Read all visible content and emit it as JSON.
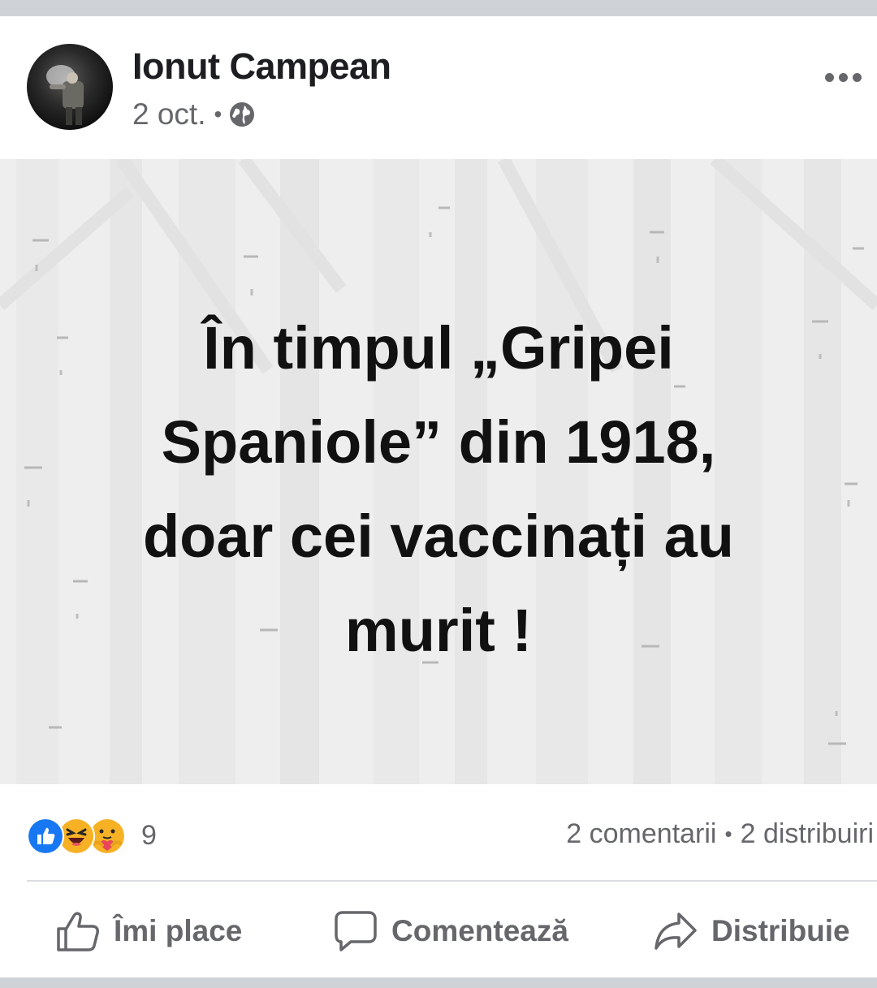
{
  "post": {
    "author": "Ionut Campean",
    "date": "2 oct.",
    "meta_separator": "•",
    "privacy_icon": "globe-icon",
    "more_icon": "more-options-icon",
    "image_text_lines": [
      "În timpul „Gripei",
      "Spaniole” din 1918,",
      "doar cei vaccinați au",
      "murit !"
    ]
  },
  "reactions": {
    "icons": [
      "like-reaction-icon",
      "haha-reaction-icon",
      "care-reaction-icon"
    ],
    "count": "9",
    "comments": "2 comentarii",
    "separator": "•",
    "shares": "2 distribuiri"
  },
  "actions": {
    "like_label": "Îmi place",
    "comment_label": "Comentează",
    "share_label": "Distribuie"
  },
  "colors": {
    "like_blue": "#1877f2",
    "reaction_yellow": "#f7b125",
    "secondary_text": "#65676b",
    "primary_text": "#1c1e21"
  }
}
